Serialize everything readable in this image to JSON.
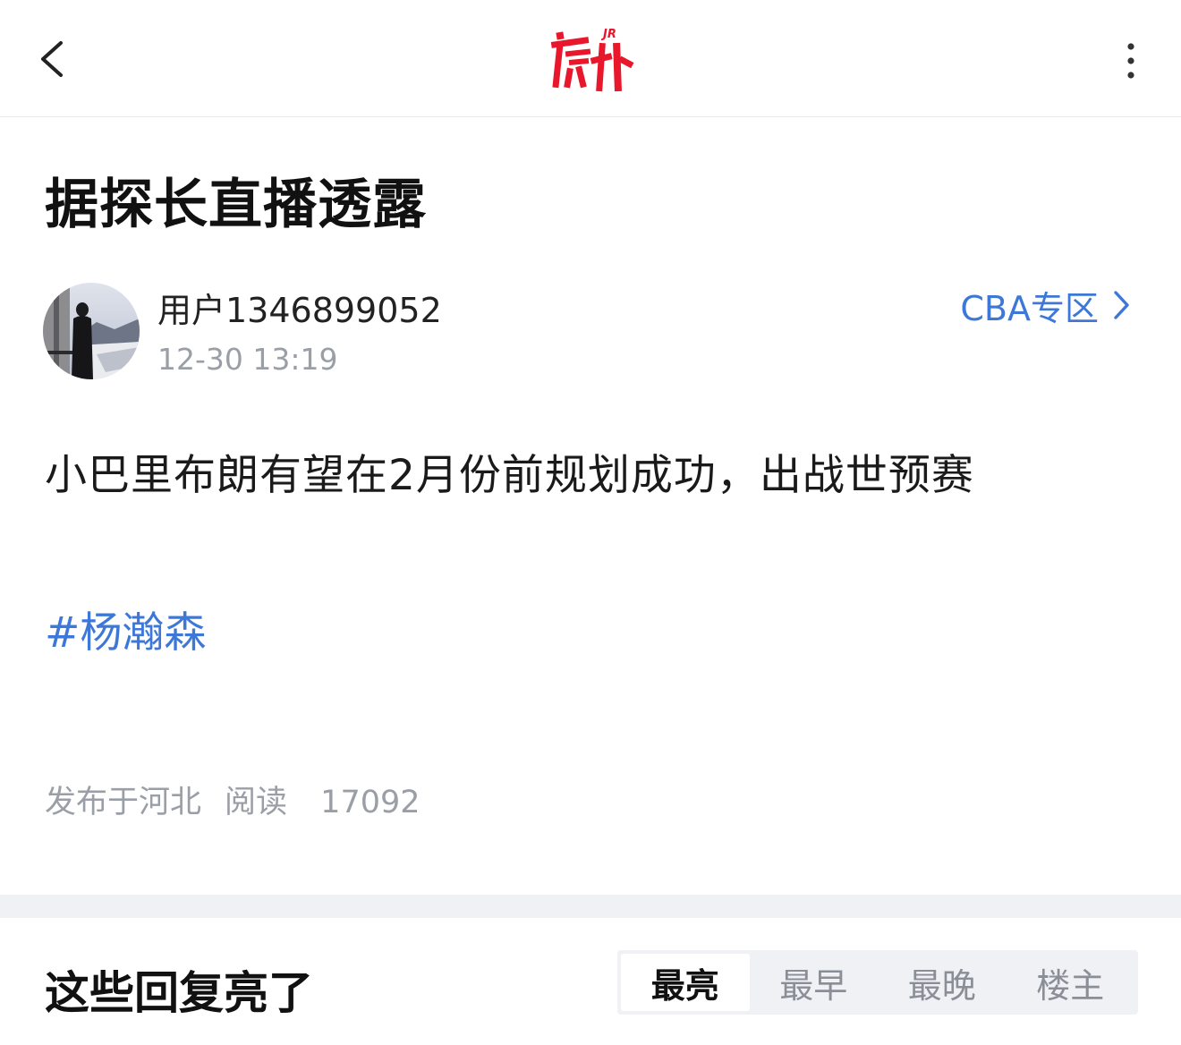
{
  "header": {
    "back_icon": "chevron-left-icon",
    "logo_text": "虎扑",
    "logo_badge": "JR",
    "more_icon": "more-vertical-icon",
    "brand_color": "#e8172b"
  },
  "post": {
    "title": "据探长直播透露",
    "author": {
      "name": "用户1346899052",
      "time": "12-30 13:19",
      "avatar_icon": "avatar-photo"
    },
    "zone_link": "CBA专区",
    "content": "小巴里布朗有望在2月份前规划成功，出战世预赛",
    "tag": "#杨瀚森",
    "location": "发布于河北",
    "read_label": "阅读",
    "read_count": "17092"
  },
  "replies": {
    "section_title": "这些回复亮了",
    "sort_tabs": [
      {
        "label": "最亮",
        "active": true
      },
      {
        "label": "最早",
        "active": false
      },
      {
        "label": "最晚",
        "active": false
      },
      {
        "label": "楼主",
        "active": false
      }
    ]
  },
  "colors": {
    "link": "#3d78d8",
    "muted": "#9a9ea6",
    "divider": "#f0f1f5"
  }
}
